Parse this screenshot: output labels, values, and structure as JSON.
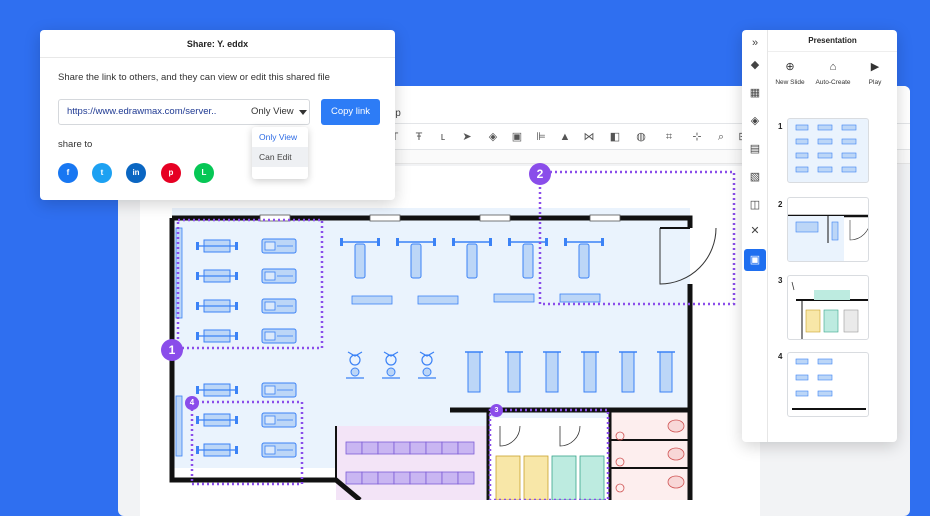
{
  "share_dialog": {
    "title": "Share: Y. eddx",
    "description": "Share the link to others, and they can view or edit this shared file",
    "link_url": "https://www.edrawmax.com/server..",
    "permission_selected": "Only View",
    "copy_button": "Copy link",
    "dropdown_options": [
      "Only View",
      "Can Edit"
    ],
    "share_to_label": "share to",
    "social": [
      {
        "name": "facebook",
        "glyph": "f",
        "color": "#1877f2"
      },
      {
        "name": "twitter",
        "glyph": "t",
        "color": "#1da1f2"
      },
      {
        "name": "linkedin",
        "glyph": "in",
        "color": "#0a66c2"
      },
      {
        "name": "pinterest",
        "glyph": "p",
        "color": "#e60023"
      },
      {
        "name": "line",
        "glyph": "L",
        "color": "#06c755"
      }
    ]
  },
  "editor": {
    "help_fragment": "lp"
  },
  "presentation": {
    "title": "Presentation",
    "tools": [
      {
        "label": "New Slide",
        "icon": "plus-circle-icon"
      },
      {
        "label": "Auto-Create",
        "icon": "auto-create-icon"
      },
      {
        "label": "Play",
        "icon": "play-icon"
      }
    ],
    "slides": [
      "1",
      "2",
      "3",
      "4"
    ]
  },
  "markers": [
    "1",
    "2",
    "3",
    "4"
  ],
  "colors": {
    "accent": "#2d7cf6",
    "marker_purple": "#8a4dea",
    "background": "#2f6ff0"
  }
}
